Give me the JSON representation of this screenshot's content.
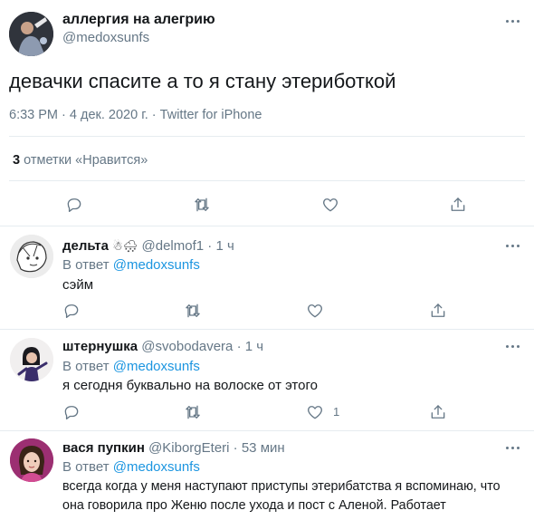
{
  "tweet": {
    "author_name": "аллергия на алегрию",
    "author_handle": "@medoxsunfs",
    "text": "девачки спасите а то я стану этериботкой",
    "time": "6:33 PM",
    "date": "4 дек. 2020 г.",
    "source": "Twitter for iPhone",
    "likes_count": "3",
    "likes_label": "отметки «Нравится»",
    "separator": "·"
  },
  "replies": [
    {
      "name": "дельта",
      "emoji": "☃🌨",
      "handle": "@delmof1",
      "time": "1 ч",
      "reply_prefix": "В ответ",
      "reply_to": "@medoxsunfs",
      "text": "сэйм",
      "like_count": ""
    },
    {
      "name": "штернушка",
      "emoji": "",
      "handle": "@svobodavera",
      "time": "1 ч",
      "reply_prefix": "В ответ",
      "reply_to": "@medoxsunfs",
      "text": "я сегодня буквально на волоске от этого",
      "like_count": "1"
    },
    {
      "name": "вася пупкин",
      "emoji": "",
      "handle": "@KiborgEteri",
      "time": "53 мин",
      "reply_prefix": "В ответ",
      "reply_to": "@medoxsunfs",
      "text_line1": "всегда когда у меня наступают приступы этерибатства я вспоминаю, что",
      "text_line2": "она говорила про Женю после ухода и пост с Аленой. Работает",
      "like_count": ""
    }
  ],
  "icons": [
    "reply-icon",
    "retweet-icon",
    "like-icon",
    "share-icon",
    "more-icon"
  ],
  "colors": {
    "link": "#1b95e0",
    "muted": "#657786",
    "divider": "#e6ecf0",
    "text": "#14171a"
  }
}
